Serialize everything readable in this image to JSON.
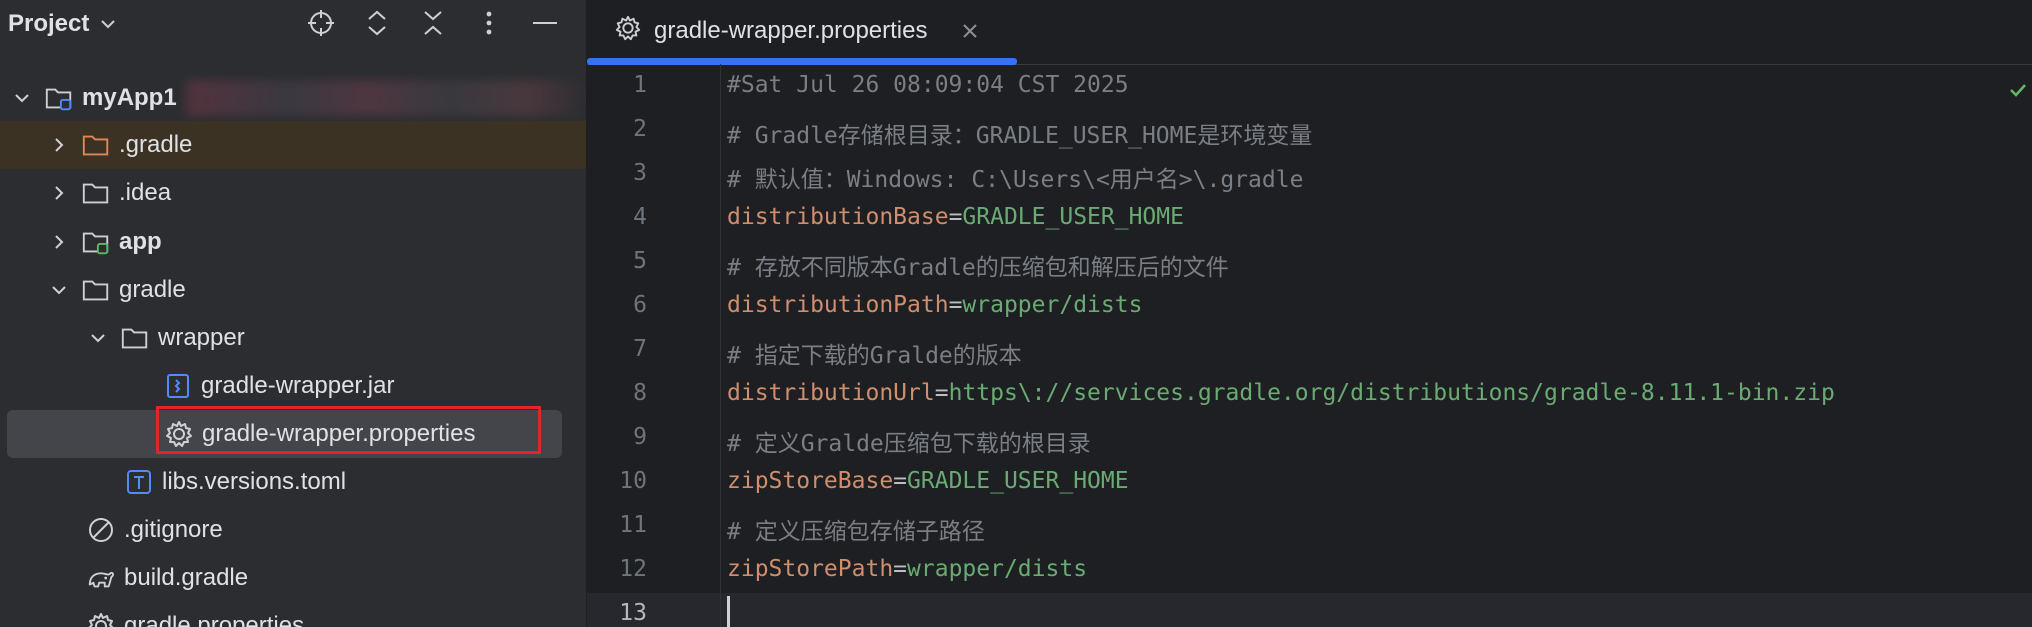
{
  "project_panel": {
    "title": "Project",
    "icons": [
      "crosshair-icon",
      "expand-all-icon",
      "collapse-all-icon",
      "more-vertical-icon",
      "minimize-icon"
    ],
    "tree": [
      {
        "label": "myApp1",
        "icon": "module-folder-icon",
        "expanded": true,
        "bold": true
      },
      {
        "label": ".gradle",
        "icon": "folder-orange-icon",
        "expanded": false
      },
      {
        "label": ".idea",
        "icon": "folder-icon",
        "expanded": false
      },
      {
        "label": "app",
        "icon": "module-folder-icon",
        "expanded": false,
        "bold": true
      },
      {
        "label": "gradle",
        "icon": "folder-icon",
        "expanded": true
      },
      {
        "label": "wrapper",
        "icon": "folder-icon",
        "expanded": true
      },
      {
        "label": "gradle-wrapper.jar",
        "icon": "jar-file-icon"
      },
      {
        "label": "gradle-wrapper.properties",
        "icon": "gear-icon",
        "selected": true
      },
      {
        "label": "libs.versions.toml",
        "icon": "toml-file-icon"
      },
      {
        "label": ".gitignore",
        "icon": "ignore-file-icon"
      },
      {
        "label": "build.gradle",
        "icon": "gradle-elephant-icon"
      },
      {
        "label": "gradle.properties",
        "icon": "gear-icon"
      }
    ]
  },
  "editor": {
    "tab": {
      "label": "gradle-wrapper.properties",
      "icon": "gear-icon",
      "active": true
    },
    "line_numbers": [
      "1",
      "2",
      "3",
      "4",
      "5",
      "6",
      "7",
      "8",
      "9",
      "10",
      "11",
      "12",
      "13"
    ],
    "lines": [
      {
        "comment": "#Sat Jul 26 08:09:04 CST 2025"
      },
      {
        "comment": "# Gradle存储根目录：GRADLE_USER_HOME是环境变量"
      },
      {
        "comment": "# 默认值：Windows: C:\\Users\\<用户名>\\.gradle"
      },
      {
        "key": "distributionBase",
        "eq": "=",
        "value": "GRADLE_USER_HOME"
      },
      {
        "comment": "# 存放不同版本Gradle的压缩包和解压后的文件"
      },
      {
        "key": "distributionPath",
        "eq": "=",
        "value": "wrapper/dists"
      },
      {
        "comment": "# 指定下载的Gralde的版本"
      },
      {
        "key": "distributionUrl",
        "eq": "=",
        "value": "https\\://services.gradle.org/distributions/gradle-8.11.1-bin.zip"
      },
      {
        "comment": "# 定义Gralde压缩包下载的根目录"
      },
      {
        "key": "zipStoreBase",
        "eq": "=",
        "value": "GRADLE_USER_HOME"
      },
      {
        "comment": "# 定义压缩包存储子路径"
      },
      {
        "key": "zipStorePath",
        "eq": "=",
        "value": "wrapper/dists"
      },
      {
        "comment": ""
      }
    ]
  },
  "colors": {
    "accent": "#3574f0",
    "highlight_border": "#e0262c",
    "comment": "#7a7e85",
    "key": "#cf8e6d",
    "value": "#6aab73"
  }
}
